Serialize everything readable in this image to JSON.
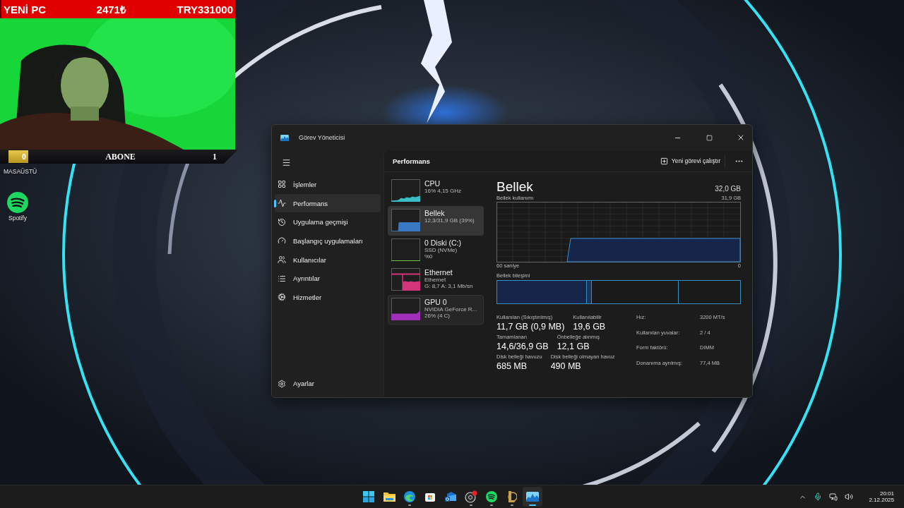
{
  "stream_overlay": {
    "goal_bar": {
      "title": "YENİ PC",
      "amount": "2471₺",
      "target": "TRY331000"
    },
    "subscriber_bar": {
      "count": "0",
      "label": "ABONE",
      "goal": "1"
    }
  },
  "desktop": {
    "label": "MASAÜSTÜ",
    "icons": [
      {
        "label": "Spotify",
        "kind": "spotify"
      }
    ]
  },
  "window": {
    "title": "Görev Yöneticisi",
    "sidebar": {
      "items": [
        {
          "kind": "processes",
          "label": "İşlemler",
          "selected": false
        },
        {
          "kind": "performance",
          "label": "Performans",
          "selected": true
        },
        {
          "kind": "history",
          "label": "Uygulama geçmişi",
          "selected": false
        },
        {
          "kind": "startup",
          "label": "Başlangıç uygulamaları",
          "selected": false
        },
        {
          "kind": "users",
          "label": "Kullanıcılar",
          "selected": false
        },
        {
          "kind": "details",
          "label": "Ayrıntılar",
          "selected": false
        },
        {
          "kind": "services",
          "label": "Hizmetler",
          "selected": false
        }
      ],
      "settings": "Ayarlar"
    },
    "header": {
      "title": "Performans",
      "run_task": "Yeni görevi çalıştır"
    },
    "resources": [
      {
        "kind": "cpu",
        "name": "CPU",
        "lines": [
          "16% 4,15 GHz"
        ],
        "color": "#3bbfc7",
        "selected": false,
        "hovered": false
      },
      {
        "kind": "memory",
        "name": "Bellek",
        "lines": [
          "12,3/31,9 GB (39%)"
        ],
        "color": "#3a78c4",
        "selected": true,
        "hovered": false
      },
      {
        "kind": "disk",
        "name": "0 Diski (C:)",
        "lines": [
          "SSD (NVMe)",
          "%0"
        ],
        "color": "#6fbf4a",
        "selected": false,
        "hovered": false
      },
      {
        "kind": "network",
        "name": "Ethernet",
        "lines": [
          "Ethernet",
          "G: 8,7 A: 3,1 Mb/sn"
        ],
        "color": "#d3357a",
        "selected": false,
        "hovered": false
      },
      {
        "kind": "gpu",
        "name": "GPU 0",
        "lines": [
          "NVIDIA GeForce R...",
          "26% (4  C)"
        ],
        "color": "#a12fb8",
        "selected": false,
        "hovered": true
      }
    ],
    "detail": {
      "title": "Bellek",
      "total": "32,0 GB",
      "usage_label": "Bellek kullanımı",
      "usage_max": "31,9 GB",
      "time_span": "60 saniye",
      "time_end": "0",
      "composition_label": "Bellek bileşimi",
      "stats": [
        [
          {
            "label": "Kullanılan (Sıkıştırılmış)",
            "value": "11,7 GB (0,9 MB)"
          },
          {
            "label": "Kullanılabilir",
            "value": "19,6 GB"
          }
        ],
        [
          {
            "label": "Tamamlanan",
            "value": "14,6/36,9 GB"
          },
          {
            "label": "Önbelleğe alınmış",
            "value": "12,1 GB"
          }
        ],
        [
          {
            "label": "Disk belleği havuzu",
            "value": "685 MB"
          },
          {
            "label": "Disk belleği olmayan havuz",
            "value": "490 MB"
          }
        ]
      ],
      "properties": [
        {
          "label": "Hız:",
          "value": "3200 MT/s"
        },
        {
          "label": "Kullanılan yuvalar:",
          "value": "2 / 4"
        },
        {
          "label": "Form faktörü:",
          "value": "DIMM"
        },
        {
          "label": "Donanıma ayrılmış:",
          "value": "77,4 MB"
        }
      ]
    }
  },
  "taskbar": {
    "apps": [
      {
        "kind": "start",
        "running": false,
        "active": false
      },
      {
        "kind": "folder",
        "running": false,
        "active": false
      },
      {
        "kind": "browser",
        "running": true,
        "active": false
      },
      {
        "kind": "store",
        "running": false,
        "active": false
      },
      {
        "kind": "mail",
        "running": false,
        "active": false
      },
      {
        "kind": "recorder",
        "running": true,
        "active": false
      },
      {
        "kind": "music",
        "running": true,
        "active": false
      },
      {
        "kind": "game",
        "running": true,
        "active": false
      },
      {
        "kind": "taskmanager",
        "running": true,
        "active": true
      }
    ],
    "tray": {
      "time": "20:01",
      "date": "2.12.2025"
    }
  }
}
